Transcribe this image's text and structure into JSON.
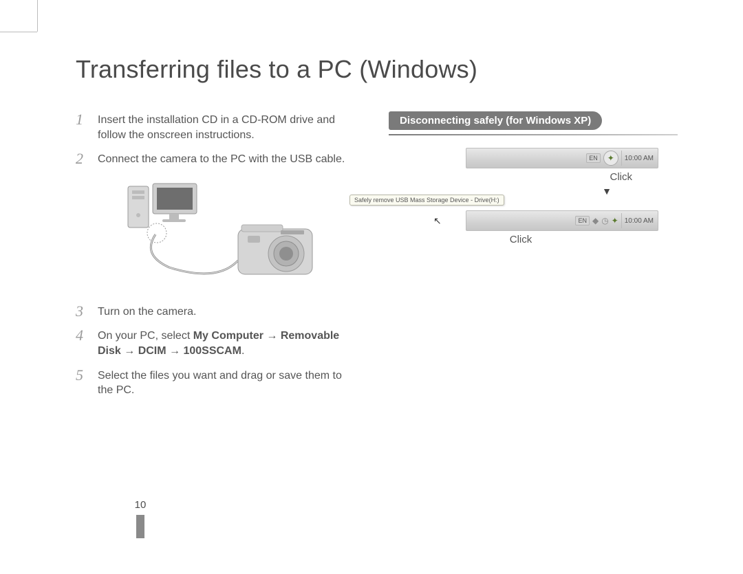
{
  "title": "Transferring files to a PC (Windows)",
  "steps": {
    "s1": {
      "n": "1",
      "text": "Insert the installation CD in a CD-ROM drive and follow the onscreen instructions."
    },
    "s2": {
      "n": "2",
      "text": "Connect the camera to the PC with the USB cable."
    },
    "s3": {
      "n": "3",
      "text": "Turn on the camera."
    },
    "s4": {
      "n": "4",
      "prefix": "On your PC, select ",
      "bold": "My Computer → Removable Disk → DCIM → 100SSCAM",
      "suffix": "."
    },
    "s5": {
      "n": "5",
      "text": "Select the files you want and drag or save them to the PC."
    }
  },
  "sidebar": {
    "heading": "Disconnecting safely (for Windows XP)",
    "tray1": {
      "lang": "EN",
      "time": "10:00 AM",
      "click": "Click"
    },
    "arrow": "▼",
    "tray2": {
      "balloon": "Safely remove USB Mass Storage Device - Drive(H:)",
      "lang": "EN",
      "time": "10:00 AM",
      "click": "Click"
    }
  },
  "page_number": "10"
}
